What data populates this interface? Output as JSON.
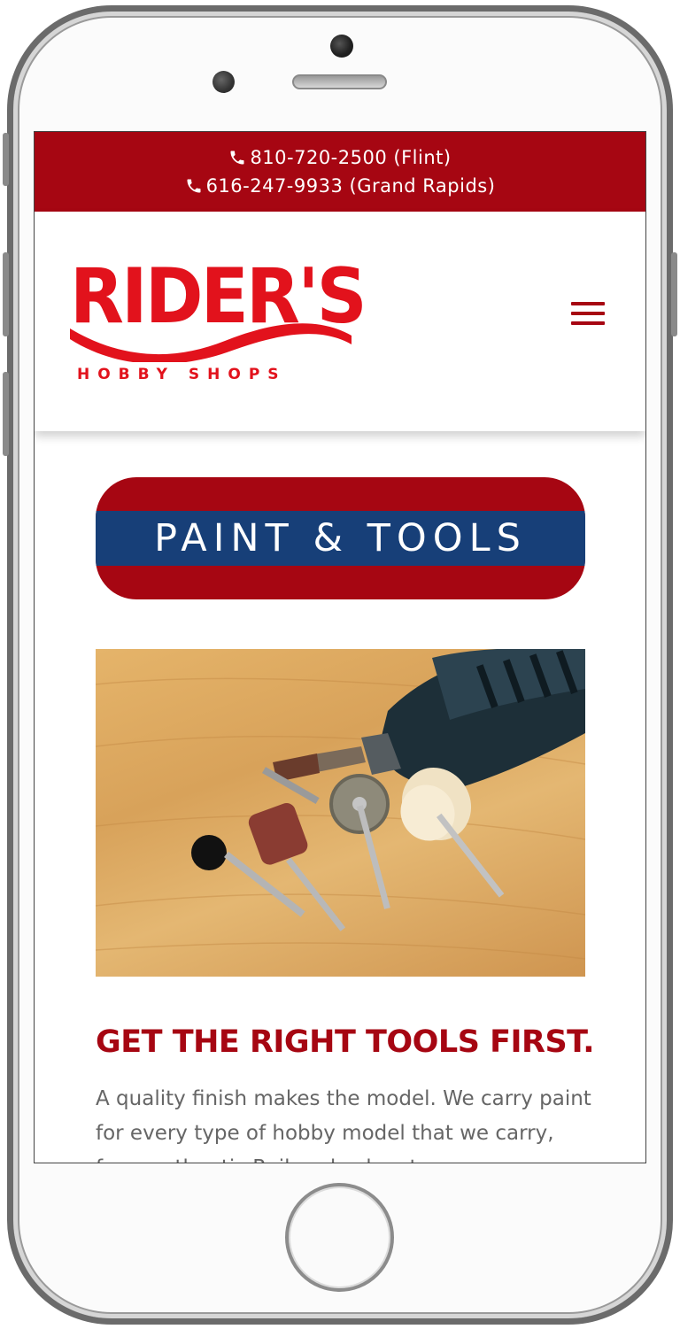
{
  "contact": {
    "phone_flint": "810-720-2500 (Flint)",
    "phone_grand_rapids": "616-247-9933 (Grand Rapids)",
    "phone_icon": "phone-icon"
  },
  "logo": {
    "main_text": "RIDER'S",
    "sub_text": "HOBBY SHOPS"
  },
  "nav": {
    "menu_icon": "hamburger-menu-icon"
  },
  "banner": {
    "title": "PAINT & TOOLS"
  },
  "hero_image": {
    "alt": "rotary tool with grinding and polishing bits"
  },
  "article": {
    "headline": "GET THE RIGHT TOOLS FIRST.",
    "body": "A quality finish makes the model.  We carry paint for every type of hobby model that we carry, from authentic Railroad colors to"
  },
  "colors": {
    "brand_red": "#a60612",
    "logo_red": "#e2121c",
    "banner_blue": "#173f78",
    "body_text": "#666666"
  }
}
